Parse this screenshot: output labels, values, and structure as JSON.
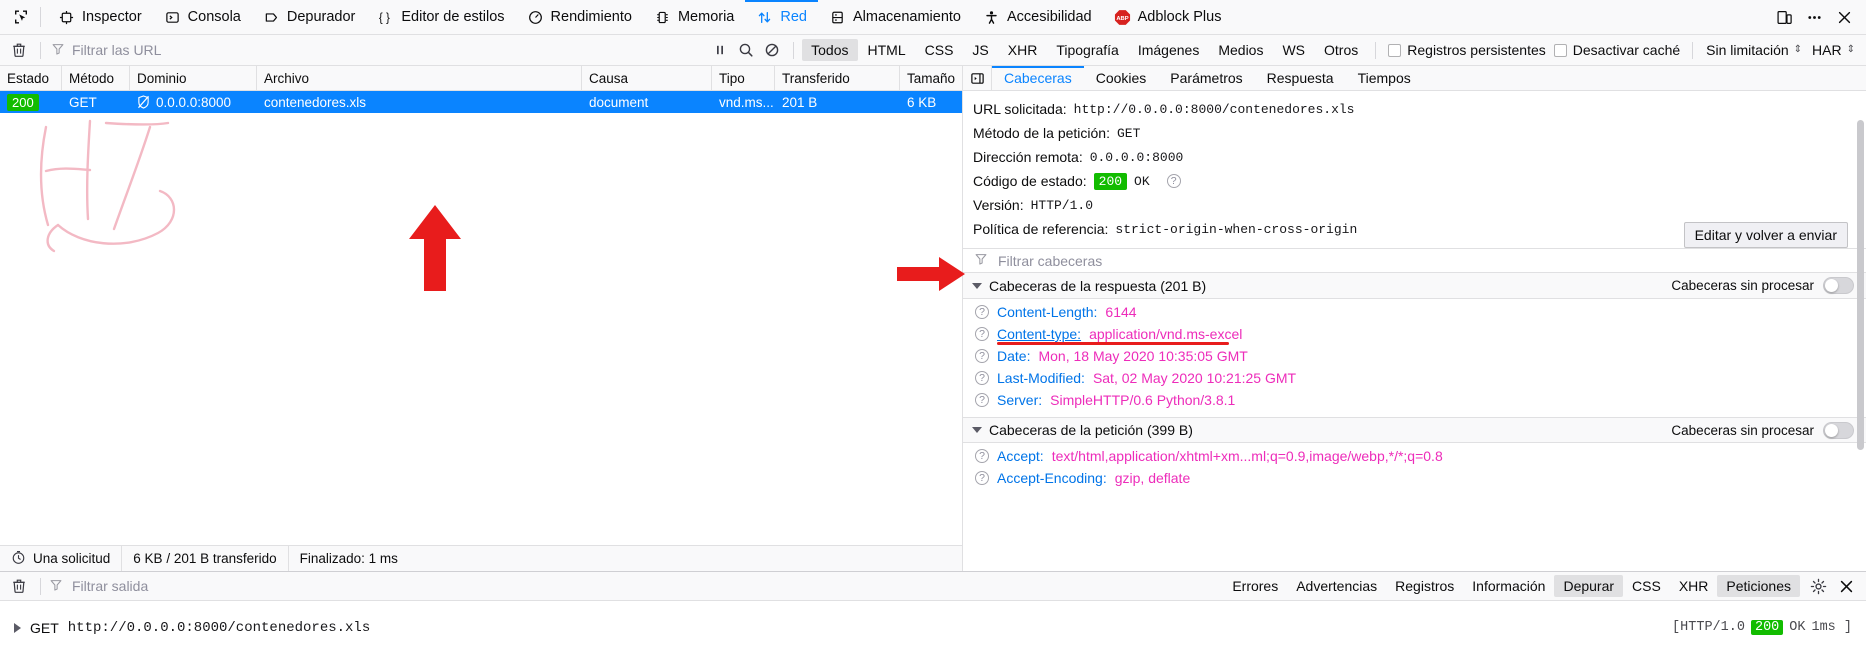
{
  "toolbar": {
    "picker_icon": "element-picker-icon",
    "tabs": [
      {
        "label": "Inspector",
        "icon": "inspector-icon",
        "selected": false
      },
      {
        "label": "Consola",
        "icon": "console-icon",
        "selected": false
      },
      {
        "label": "Depurador",
        "icon": "debugger-icon",
        "selected": false
      },
      {
        "label": "Editor de estilos",
        "icon": "style-editor-icon",
        "selected": false
      },
      {
        "label": "Rendimiento",
        "icon": "performance-icon",
        "selected": false
      },
      {
        "label": "Memoria",
        "icon": "memory-icon",
        "selected": false
      },
      {
        "label": "Red",
        "icon": "network-icon",
        "selected": true
      },
      {
        "label": "Almacenamiento",
        "icon": "storage-icon",
        "selected": false
      },
      {
        "label": "Accesibilidad",
        "icon": "accessibility-icon",
        "selected": false
      },
      {
        "label": "Adblock Plus",
        "icon": "adblock-plus-icon",
        "selected": false
      }
    ],
    "right_buttons": [
      {
        "name": "responsive-design-mode-icon"
      },
      {
        "name": "meatball-menu-icon"
      },
      {
        "name": "close-devtools-icon"
      }
    ]
  },
  "filter_bar": {
    "clear_icon": "trash-icon",
    "url_filter_placeholder": "Filtrar las URL",
    "url_filter_value": "",
    "pause_icon": "pause-icon",
    "search_icon": "search-icon",
    "block_icon": "block-icon",
    "type_filters": [
      {
        "label": "Todos",
        "active": true
      },
      {
        "label": "HTML",
        "active": false
      },
      {
        "label": "CSS",
        "active": false
      },
      {
        "label": "JS",
        "active": false
      },
      {
        "label": "XHR",
        "active": false
      },
      {
        "label": "Tipografía",
        "active": false
      },
      {
        "label": "Imágenes",
        "active": false
      },
      {
        "label": "Medios",
        "active": false
      },
      {
        "label": "WS",
        "active": false
      },
      {
        "label": "Otros",
        "active": false
      }
    ],
    "persistent_logs": {
      "label": "Registros persistentes",
      "checked": false
    },
    "disable_cache": {
      "label": "Desactivar caché",
      "checked": false
    },
    "throttling": "Sin limitación",
    "har": "HAR"
  },
  "request_table": {
    "columns": [
      "Estado",
      "Método",
      "Dominio",
      "Archivo",
      "Causa",
      "Tipo",
      "Transferido",
      "Tamaño"
    ],
    "rows": [
      {
        "status": "200",
        "method": "GET",
        "domain": "0.0.0.0:8000",
        "domain_icon": "shield-off-icon",
        "file": "contenedores.xls",
        "cause": "document",
        "type": "vnd.ms...",
        "transferred": "201 B",
        "size": "6 KB",
        "selected": true
      }
    ]
  },
  "request_status_bar": {
    "clock_icon": "clock-icon",
    "requests": "Una solicitud",
    "transferred": "6 KB / 201 B transferido",
    "finished": "Finalizado: 1 ms"
  },
  "details": {
    "back_icon": "panel-toggle-icon",
    "tabs": [
      {
        "label": "Cabeceras",
        "selected": true
      },
      {
        "label": "Cookies",
        "selected": false
      },
      {
        "label": "Parámetros",
        "selected": false
      },
      {
        "label": "Respuesta",
        "selected": false
      },
      {
        "label": "Tiempos",
        "selected": false
      }
    ],
    "summary": [
      {
        "label": "URL solicitada:",
        "value": "http://0.0.0.0:8000/contenedores.xls"
      },
      {
        "label": "Método de la petición:",
        "value": "GET"
      },
      {
        "label": "Dirección remota:",
        "value": "0.0.0.0:8000"
      },
      {
        "label": "Código de estado:",
        "value": "200",
        "status_text": "OK",
        "is_status": true
      },
      {
        "label": "Versión:",
        "value": "HTTP/1.0"
      },
      {
        "label": "Política de referencia:",
        "value": "strict-origin-when-cross-origin"
      }
    ],
    "edit_resend_label": "Editar y volver a enviar",
    "headers_filter_placeholder": "Filtrar cabeceras",
    "headers_filter_value": "",
    "groups": [
      {
        "title": "Cabeceras de la respuesta (201 B)",
        "raw_label": "Cabeceras sin procesar",
        "raw_enabled": false,
        "headers": [
          {
            "name": "Content-Length:",
            "value": "6144",
            "highlighted": false
          },
          {
            "name": "Content-type:",
            "value": "application/vnd.ms-excel",
            "highlighted": true
          },
          {
            "name": "Date:",
            "value": "Mon, 18 May 2020 10:35:05 GMT",
            "highlighted": false
          },
          {
            "name": "Last-Modified:",
            "value": "Sat, 02 May 2020 10:21:25 GMT",
            "highlighted": false
          },
          {
            "name": "Server:",
            "value": "SimpleHTTP/0.6 Python/3.8.1",
            "highlighted": false
          }
        ]
      },
      {
        "title": "Cabeceras de la petición (399 B)",
        "raw_label": "Cabeceras sin procesar",
        "raw_enabled": false,
        "headers": [
          {
            "name": "Accept:",
            "value": "text/html,application/xhtml+xm...ml;q=0.9,image/webp,*/*;q=0.8",
            "highlighted": false
          },
          {
            "name": "Accept-Encoding:",
            "value": "gzip, deflate",
            "highlighted": false
          }
        ]
      }
    ]
  },
  "console": {
    "clear_icon": "trash-icon",
    "filter_placeholder": "Filtrar salida",
    "filter_value": "",
    "pills": [
      {
        "label": "Errores",
        "active": false
      },
      {
        "label": "Advertencias",
        "active": false
      },
      {
        "label": "Registros",
        "active": false
      },
      {
        "label": "Información",
        "active": false
      },
      {
        "label": "Depurar",
        "active": true
      },
      {
        "label": "CSS",
        "active": false
      },
      {
        "label": "XHR",
        "active": false
      },
      {
        "label": "Peticiones",
        "active": true
      }
    ],
    "settings_icon": "gear-icon",
    "close_icon": "close-icon",
    "entry": {
      "method": "GET",
      "url": "http://0.0.0.0:8000/contenedores.xls",
      "protocol": "[HTTP/1.0",
      "status": "200",
      "status_text": "OK",
      "time": "1ms ]"
    }
  },
  "colors": {
    "accent": "#0a84ff",
    "status_ok": "#12bc00",
    "header_name": "#0074e8",
    "header_value": "#ed2cba",
    "annotation_red": "#e81c1c"
  }
}
